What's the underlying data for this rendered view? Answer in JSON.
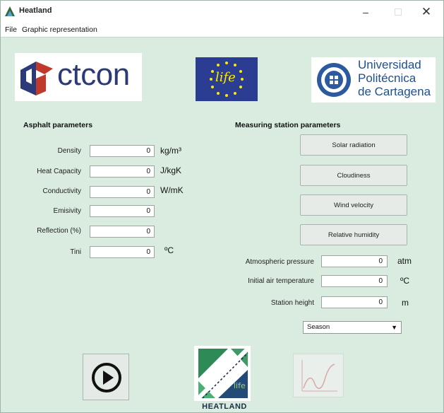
{
  "window": {
    "title": "Heatland",
    "minimize_glyph": "–",
    "close_glyph": "✕"
  },
  "menu": {
    "file": "File",
    "graphic": "Graphic representation"
  },
  "logos": {
    "ctcon": "ctcon",
    "life": "life",
    "upct_line1": "Universidad",
    "upct_line2": "Politécnica",
    "upct_line3": "de Cartagena",
    "heatland_mark": "life",
    "heatland": "HEATLAND"
  },
  "asphalt": {
    "title": "Asphalt parameters",
    "params": [
      {
        "label": "Density",
        "value": "0",
        "unit": "kg/m³"
      },
      {
        "label": "Heat Capacity",
        "value": "0",
        "unit": "J/kgK"
      },
      {
        "label": "Conductivity",
        "value": "0",
        "unit": "W/mK"
      },
      {
        "label": "Emisivity",
        "value": "0",
        "unit": ""
      },
      {
        "label": "Reflection (%)",
        "value": "0",
        "unit": ""
      },
      {
        "label": "Tini",
        "value": "0",
        "unit": "ºC"
      }
    ]
  },
  "station": {
    "title": "Measuring station parameters",
    "buttons": [
      "Solar radiation",
      "Cloudiness",
      "Wind velocity",
      "Relative humidity"
    ],
    "fields": [
      {
        "label": "Atmospheric pressure",
        "value": "0",
        "unit": "atm"
      },
      {
        "label": "Initial air temperature",
        "value": "0",
        "unit": "ºC"
      },
      {
        "label": "Station height",
        "value": "0",
        "unit": "m"
      }
    ],
    "season": "Season"
  },
  "icons": {
    "app": "heatland-app-icon",
    "play": "play-icon",
    "graph": "line-graph-icon"
  }
}
